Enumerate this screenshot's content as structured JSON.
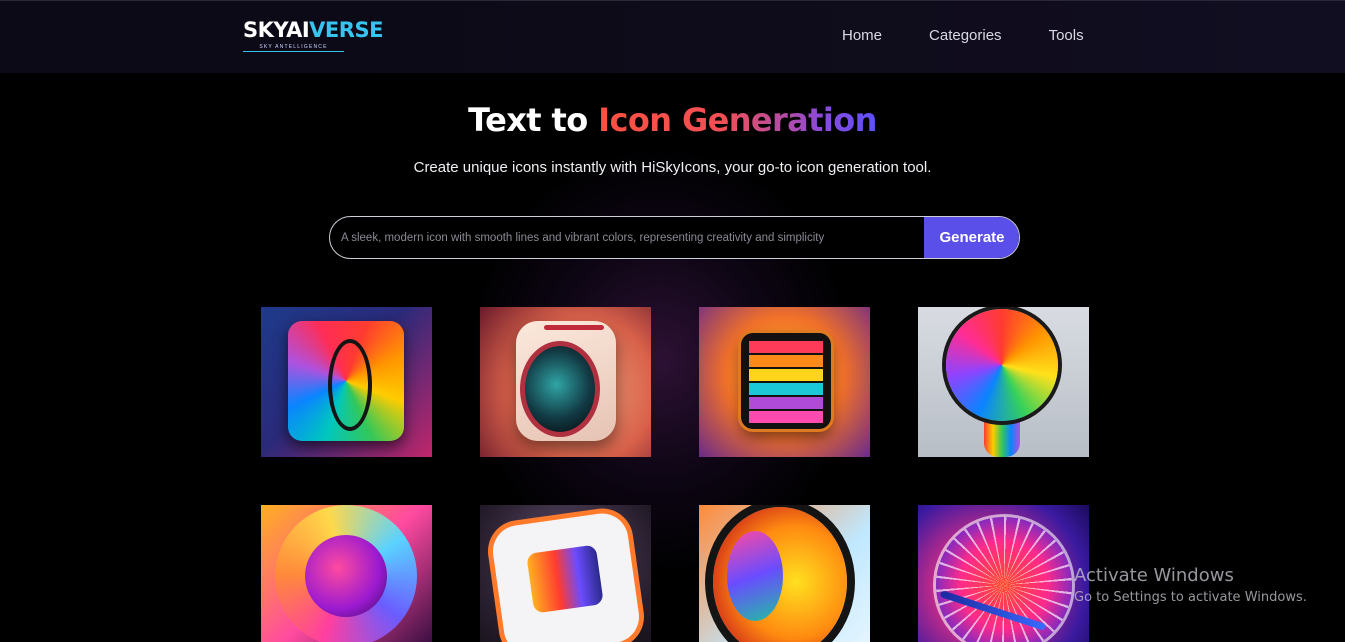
{
  "header": {
    "logo": {
      "text_main": "SKYAI",
      "text_accent": "VERSE",
      "tagline": "SKY ANTELLIGENCE"
    },
    "nav": [
      {
        "label": "Home"
      },
      {
        "label": "Categories"
      },
      {
        "label": "Tools"
      }
    ]
  },
  "hero": {
    "title_plain": "Text to ",
    "title_gradient": "Icon Generation",
    "subtitle": "Create unique icons instantly with HiSkyIcons, your go-to icon generation tool."
  },
  "search": {
    "placeholder": "A sleek, modern icon with smooth lines and vibrant colors, representing creativity and simplicity",
    "value": "",
    "button_label": "Generate"
  },
  "gallery": {
    "items": [
      {
        "icon": "rainbow-square-knot-icon"
      },
      {
        "icon": "cream-lens-box-icon"
      },
      {
        "icon": "striped-tablet-icon"
      },
      {
        "icon": "rainbow-lightbulb-icon"
      },
      {
        "icon": "neon-ring-icon"
      },
      {
        "icon": "rainbow-device-icon"
      },
      {
        "icon": "swirl-egg-icon"
      },
      {
        "icon": "neon-wheel-pen-icon"
      }
    ]
  },
  "watermark": {
    "title": "Activate Windows",
    "subtitle": "Go to Settings to activate Windows."
  },
  "colors": {
    "background": "#000000",
    "header_bg": "#0e0b1a",
    "logo_accent": "#38c4f0",
    "button": "#5a4fe8",
    "title_gradient_start": "#ff5040",
    "title_gradient_end": "#5c50ff"
  }
}
